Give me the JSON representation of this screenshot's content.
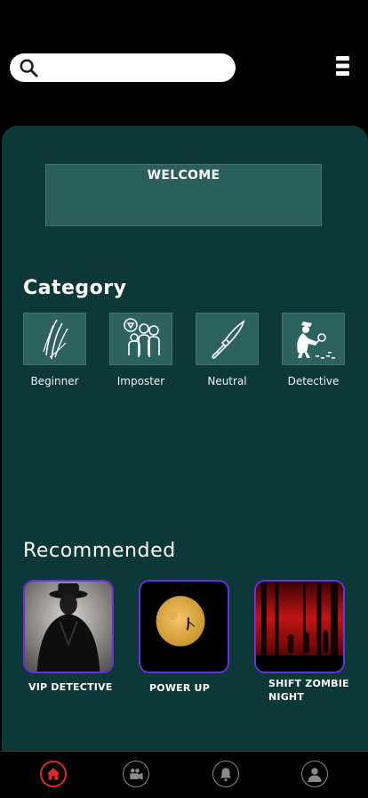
{
  "search": {
    "placeholder": "",
    "value": ""
  },
  "welcome": {
    "text": "WELCOME"
  },
  "category": {
    "title": "Category",
    "items": [
      {
        "label": "Beginner",
        "icon": "claw-scratch-icon"
      },
      {
        "label": "Imposter",
        "icon": "crowd-icon"
      },
      {
        "label": "Neutral",
        "icon": "knife-icon"
      },
      {
        "label": "Detective",
        "icon": "detective-icon"
      }
    ]
  },
  "recommended": {
    "title": "Recommended",
    "items": [
      {
        "label": "VIP DETECTIVE",
        "image": "detective-man-image"
      },
      {
        "label": "POWER UP",
        "image": "full-moon-image"
      },
      {
        "label": "SHIFT ZOMBIE NIGHT",
        "image": "zombie-forest-image"
      }
    ]
  },
  "nav": {
    "items": [
      {
        "name": "home",
        "icon": "home-icon",
        "active": true
      },
      {
        "name": "videos",
        "icon": "camera-icon",
        "active": false
      },
      {
        "name": "notifications",
        "icon": "bell-icon",
        "active": false
      },
      {
        "name": "profile",
        "icon": "user-icon",
        "active": false
      }
    ]
  },
  "colors": {
    "background": "#000000",
    "panel": "#0c3938",
    "tile": "#2d625f",
    "accent_purple": "#6b2fe0",
    "active_red": "#e0282a"
  }
}
